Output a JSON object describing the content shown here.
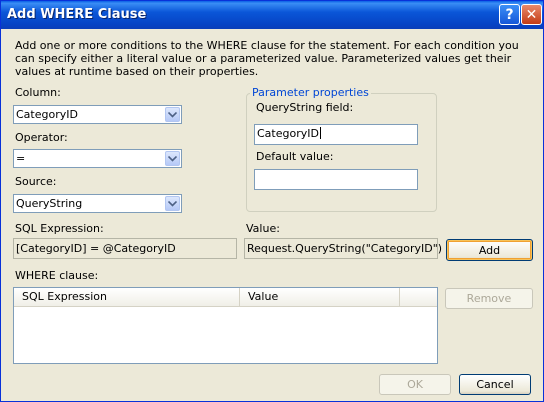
{
  "window": {
    "title": "Add WHERE Clause",
    "help_icon": "question-mark",
    "close_icon": "x"
  },
  "description": "Add one or more conditions to the WHERE clause for the statement. For each condition you can specify either a literal value or a parameterized value. Parameterized values get their values at runtime based on their properties.",
  "column": {
    "label": "Column:",
    "value": "CategoryID"
  },
  "operator": {
    "label": "Operator:",
    "value": "="
  },
  "source": {
    "label": "Source:",
    "value": "QueryString"
  },
  "parameter_properties": {
    "legend": "Parameter properties",
    "querystring_label": "QueryString field:",
    "querystring_value": "CategoryID",
    "default_label": "Default value:",
    "default_value": ""
  },
  "sql_expression": {
    "label": "SQL Expression:",
    "value": "[CategoryID] = @CategoryID"
  },
  "value_field": {
    "label": "Value:",
    "value": "Request.QueryString(\"CategoryID\")"
  },
  "buttons": {
    "add": "Add",
    "remove": "Remove",
    "ok": "OK",
    "cancel": "Cancel"
  },
  "where_clause": {
    "label": "WHERE clause:",
    "columns": [
      "SQL Expression",
      "Value"
    ],
    "rows": []
  },
  "colors": {
    "title_bar": "#0a56d8",
    "dialog_bg": "#ece9d8",
    "legend_text": "#0046d5",
    "default_button_ring": "#f0a132"
  }
}
